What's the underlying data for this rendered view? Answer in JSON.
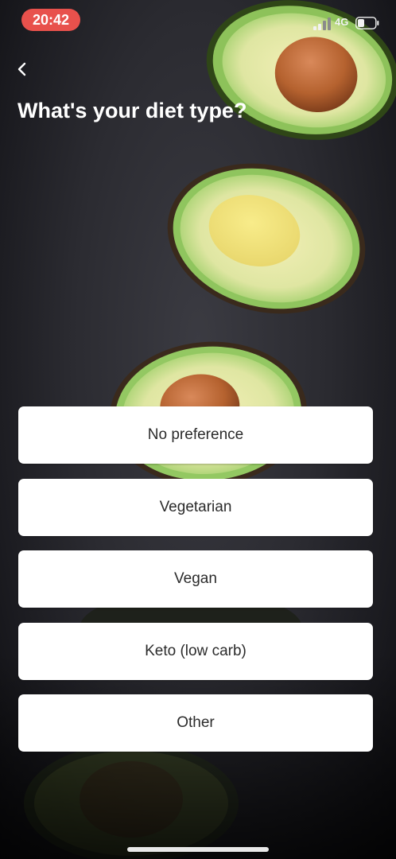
{
  "status_bar": {
    "time": "20:42",
    "network": "4G",
    "time_pill_color": "#e8514c"
  },
  "header": {
    "back_icon": "chevron-left-icon",
    "title": "What's your diet type?"
  },
  "options": [
    {
      "label": "No preference"
    },
    {
      "label": "Vegetarian"
    },
    {
      "label": "Vegan"
    },
    {
      "label": "Keto (low carb)"
    },
    {
      "label": "Other"
    }
  ],
  "colors": {
    "background": "#2b2b31",
    "option_background": "#ffffff",
    "option_text": "#2b2b2b",
    "title_text": "#ffffff",
    "avocado_skin": "#3d5a1f",
    "avocado_flesh": "#e8eca0",
    "avocado_pit": "#b8673a"
  }
}
